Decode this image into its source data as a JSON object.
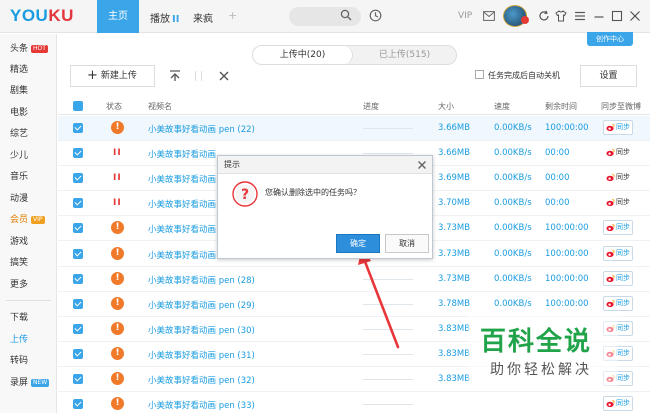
{
  "brand": {
    "logo_you": "YOU",
    "logo_ku": "KU"
  },
  "topbar": {
    "home": "主页",
    "play": "播放",
    "play_bars": "II",
    "laifeng": "来疯",
    "plus": "+",
    "vip": "VIP"
  },
  "sidebar": {
    "items": [
      {
        "label": "头条",
        "tag": "HOT"
      },
      {
        "label": "精选"
      },
      {
        "label": "剧集"
      },
      {
        "label": "电影"
      },
      {
        "label": "综艺"
      },
      {
        "label": "少儿"
      },
      {
        "label": "音乐"
      },
      {
        "label": "动漫"
      },
      {
        "label": "会员",
        "tag": "VIP"
      },
      {
        "label": "游戏"
      },
      {
        "label": "搞笑"
      },
      {
        "label": "更多"
      },
      {
        "label": "下载"
      },
      {
        "label": "上传"
      },
      {
        "label": "转码"
      },
      {
        "label": "录屏",
        "tag": "NEW"
      }
    ]
  },
  "create_center": "创作中心",
  "tabs": {
    "uploading": "上传中(20)",
    "uploaded": "已上传(515)"
  },
  "toolbar": {
    "new_upload": "新建上传",
    "auto_shutdown": "任务完成后自动关机",
    "settings": "设置"
  },
  "table": {
    "headers": {
      "status": "状态",
      "name": "视频名",
      "progress": "进度",
      "size": "大小",
      "speed": "速度",
      "remaining": "剩余时间",
      "sync": "同步至微博"
    },
    "sync_label": "同步",
    "rows": [
      {
        "status": "error",
        "name": "小美故事好看动画 pen (22)",
        "size": "3.66MB",
        "speed": "0.00KB/s",
        "remaining": "100:00:00",
        "sync": "boxed"
      },
      {
        "status": "paused",
        "name": "小美故事好看动画",
        "size": "3.66MB",
        "speed": "0.00KB/s",
        "remaining": "00:00",
        "sync": "plain"
      },
      {
        "status": "paused",
        "name": "小美故事好看动画",
        "size": "3.69MB",
        "speed": "0.00KB/s",
        "remaining": "00:00",
        "sync": "plain"
      },
      {
        "status": "paused",
        "name": "小美故事好看动画",
        "size": "3.70MB",
        "speed": "0.00KB/s",
        "remaining": "00:00",
        "sync": "plain"
      },
      {
        "status": "error",
        "name": "小美故事好看动画",
        "size": "3.73MB",
        "speed": "0.00KB/s",
        "remaining": "100:00:00",
        "sync": "boxed"
      },
      {
        "status": "error",
        "name": "小美故事好看动画",
        "size": "3.73MB",
        "speed": "0.00KB/s",
        "remaining": "100:00:00",
        "sync": "boxed"
      },
      {
        "status": "error",
        "name": "小美故事好看动画 pen (28)",
        "size": "3.73MB",
        "speed": "0.00KB/s",
        "remaining": "100:00:00",
        "sync": "boxed"
      },
      {
        "status": "error",
        "name": "小美故事好看动画 pen (29)",
        "size": "3.78MB",
        "speed": "0.00KB/s",
        "remaining": "100:00:00",
        "sync": "boxed"
      },
      {
        "status": "error",
        "name": "小美故事好看动画 pen (30)",
        "size": "3.83MB",
        "speed": "",
        "remaining": "",
        "sync": "boxed"
      },
      {
        "status": "error",
        "name": "小美故事好看动画 pen (31)",
        "size": "3.83MB",
        "speed": "",
        "remaining": "",
        "sync": "boxed"
      },
      {
        "status": "error",
        "name": "小美故事好看动画 pen (32)",
        "size": "3.83MB",
        "speed": "",
        "remaining": "",
        "sync": "boxed"
      },
      {
        "status": "error",
        "name": "小美故事好看动画 pen (33)",
        "size": "",
        "speed": "",
        "remaining": "",
        "sync": "boxed"
      }
    ]
  },
  "dialog": {
    "title": "提示",
    "message": "您确认删除选中的任务吗？",
    "ok": "确定",
    "cancel": "取消"
  },
  "watermark": {
    "title": "百科全说",
    "subtitle": "助你轻松解决"
  },
  "colors": {
    "accent": "#3aa5e8",
    "link": "#1a9ce0",
    "error": "#f07a2a",
    "paused": "#e53935",
    "annotation": "#e8363a",
    "watermark": "#21a34a"
  }
}
